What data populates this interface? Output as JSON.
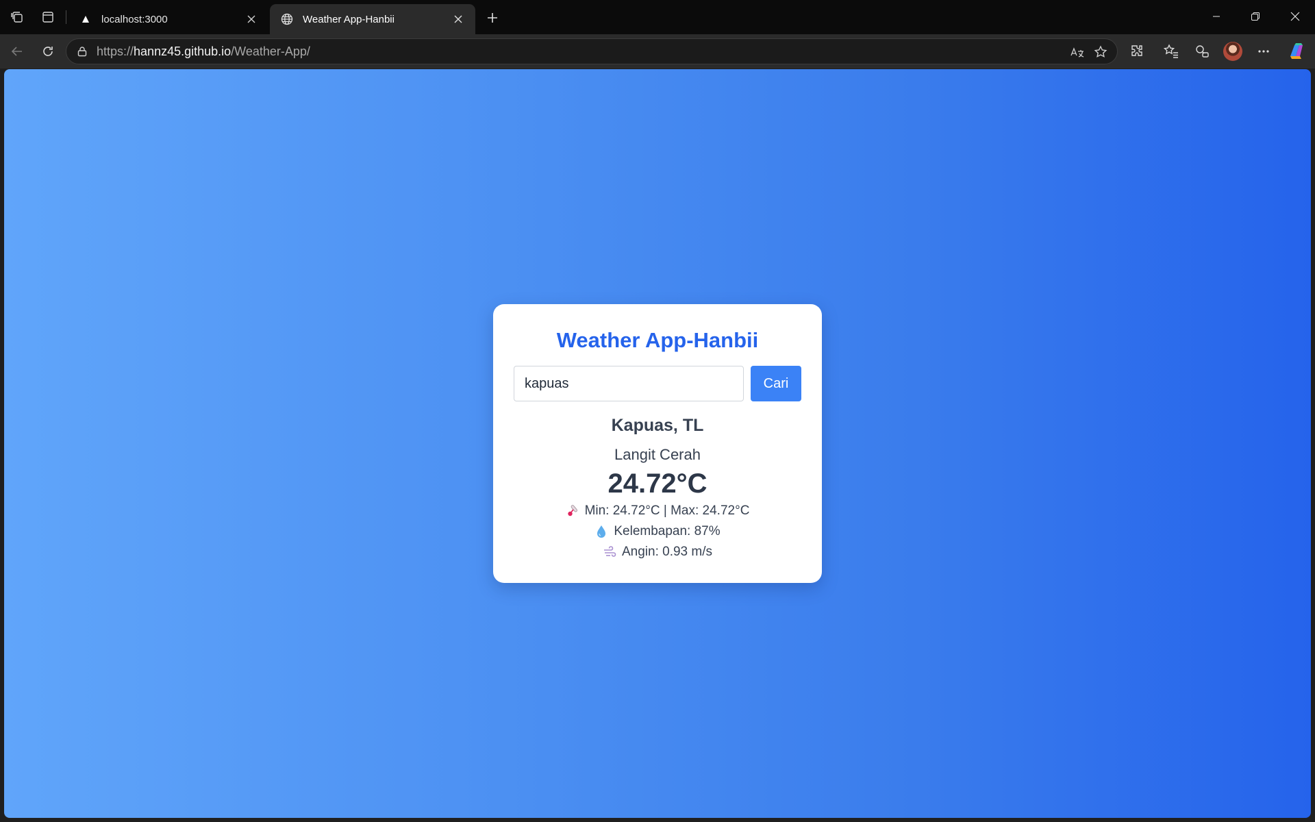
{
  "browser": {
    "tabs": [
      {
        "title": "localhost:3000",
        "icon": "triangle-icon",
        "active": false
      },
      {
        "title": "Weather App-Hanbii",
        "icon": "globe-icon",
        "active": true
      }
    ],
    "url": {
      "scheme": "https://",
      "host": "hannz45.github.io",
      "path": "/Weather-App/"
    }
  },
  "app": {
    "title": "Weather App-Hanbii",
    "search": {
      "value": "kapuas",
      "button_label": "Cari"
    },
    "weather": {
      "city": "Kapuas, TL",
      "description": "Langit Cerah",
      "temperature": "24.72°C",
      "minmax": "Min: 24.72°C | Max: 24.72°C",
      "humidity": "Kelembapan: 87%",
      "wind": "Angin: 0.93 m/s"
    },
    "colors": {
      "title": "#2563eb",
      "button": "#3b82f6",
      "gradient_start": "#60a5fa",
      "gradient_end": "#2563eb"
    }
  }
}
